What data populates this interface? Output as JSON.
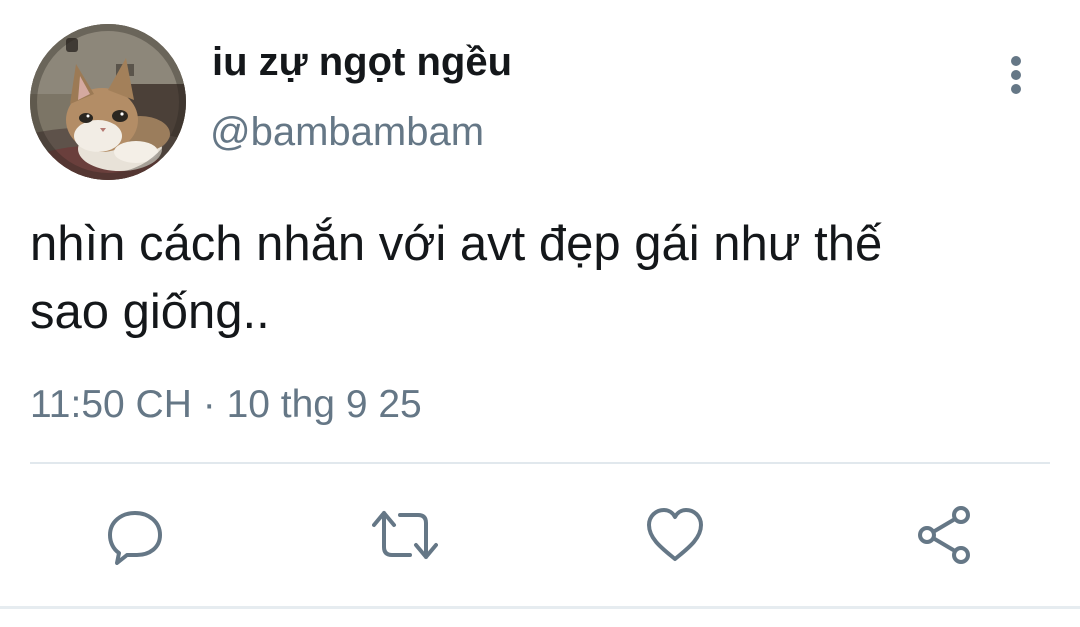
{
  "tweet": {
    "display_name": "iu zự ngọt ngều",
    "handle": "@bambambam",
    "text_line1": "nhìn cách nhắn với avt đẹp gái như thế",
    "text_line2": "sao giống..",
    "time": "11:50 CH",
    "separator": "·",
    "date": "10 thg 9 25"
  },
  "icons": {
    "more": "more-vertical-icon",
    "reply": "reply-icon",
    "retweet": "retweet-icon",
    "like": "heart-icon",
    "share": "share-icon",
    "action_color": "#657786"
  }
}
